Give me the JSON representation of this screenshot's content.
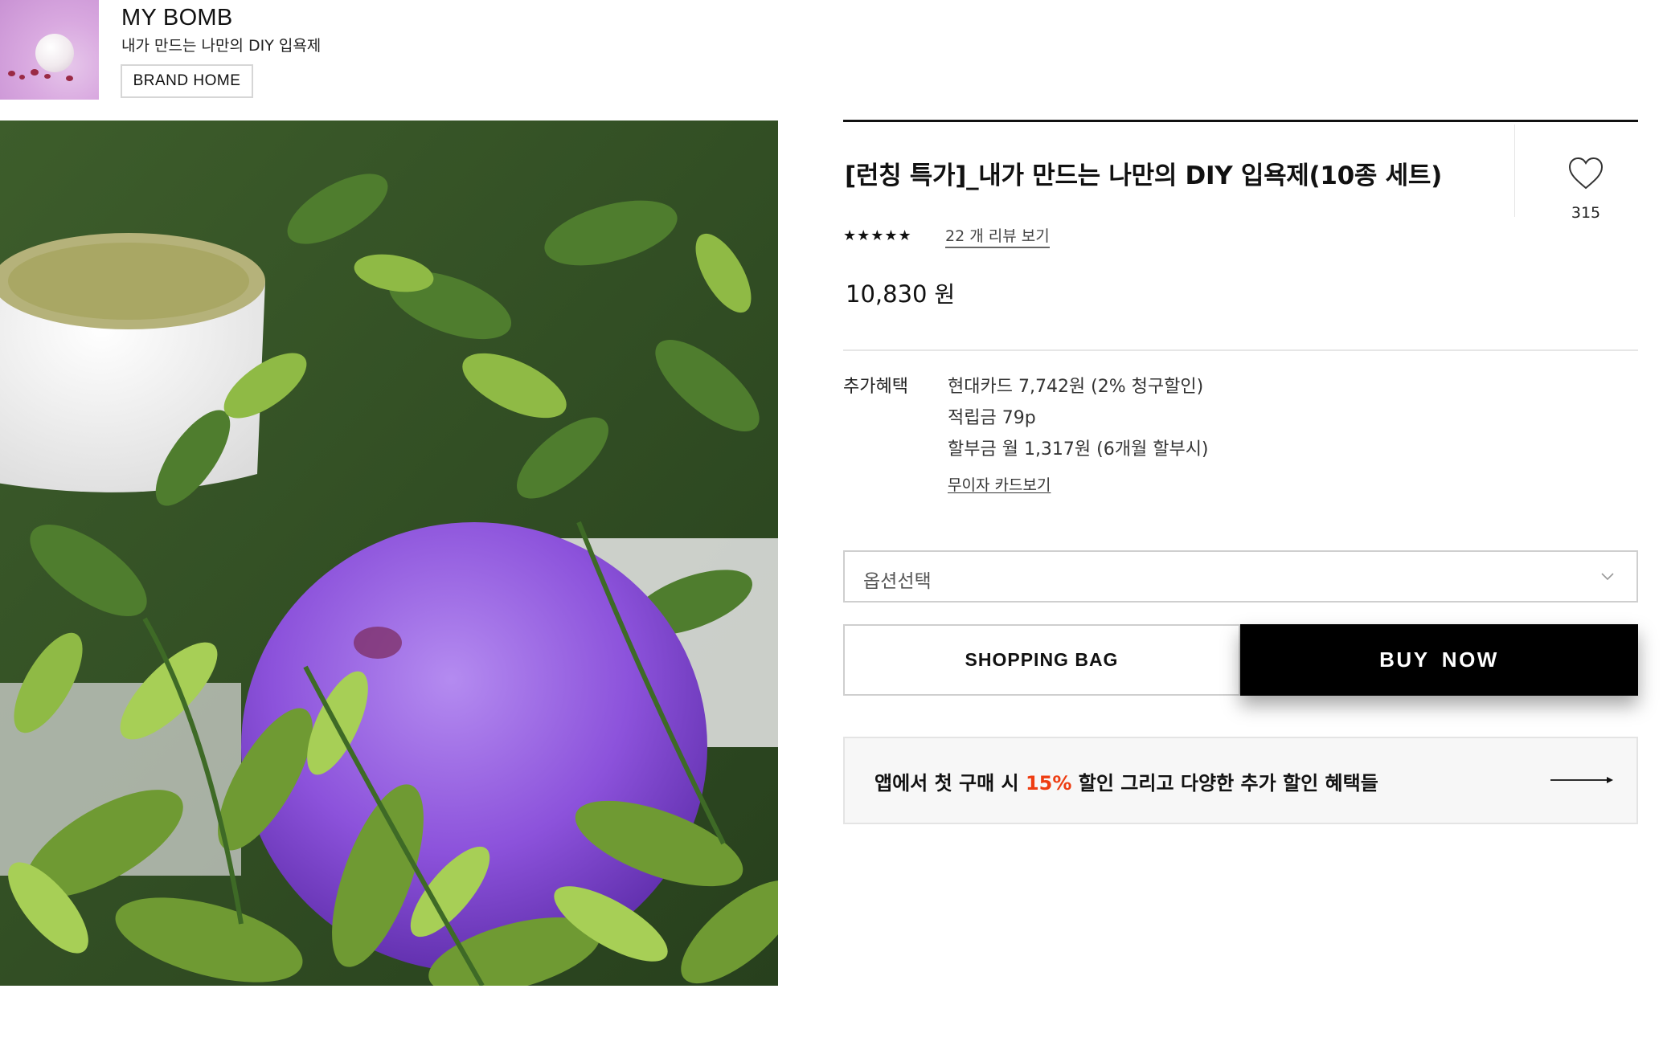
{
  "brand": {
    "name": "MY BOMB",
    "tagline": "내가 만드는 나만의 DIY 입욕제",
    "home_button": "BRAND HOME"
  },
  "product": {
    "title": "[런칭 특가]_내가 만드는 나만의 DIY 입욕제(10종 세트)",
    "wishlist_count": "315",
    "rating_stars": "★★★★★",
    "rating": 5,
    "review_link": "22 개 리뷰 보기",
    "price_value": "10,830",
    "price_unit": "원"
  },
  "benefits": {
    "label": "추가혜택",
    "lines": [
      "현대카드 7,742원 (2% 청구할인)",
      "적립금 79p",
      "할부금 월 1,317원 (6개월 할부시)"
    ],
    "card_link": "무이자 카드보기"
  },
  "option_select": {
    "placeholder": "옵션선택"
  },
  "actions": {
    "shopping_bag": "SHOPPING BAG",
    "buy_now": "BUY NOW"
  },
  "promo": {
    "text_before": "앱에서 첫 구매 시 ",
    "highlight": "15%",
    "text_after": " 할인 그리고 다양한 추가 할인 혜택들"
  },
  "colors": {
    "accent": "#ee3d12",
    "buy_button": "#000000",
    "brand_thumb": "#d9a9e0",
    "bath_bomb": "#8a4fd6"
  },
  "icons": {
    "wishlist": "heart-outline-icon",
    "select": "chevron-down-icon",
    "promo": "arrow-right-icon"
  }
}
